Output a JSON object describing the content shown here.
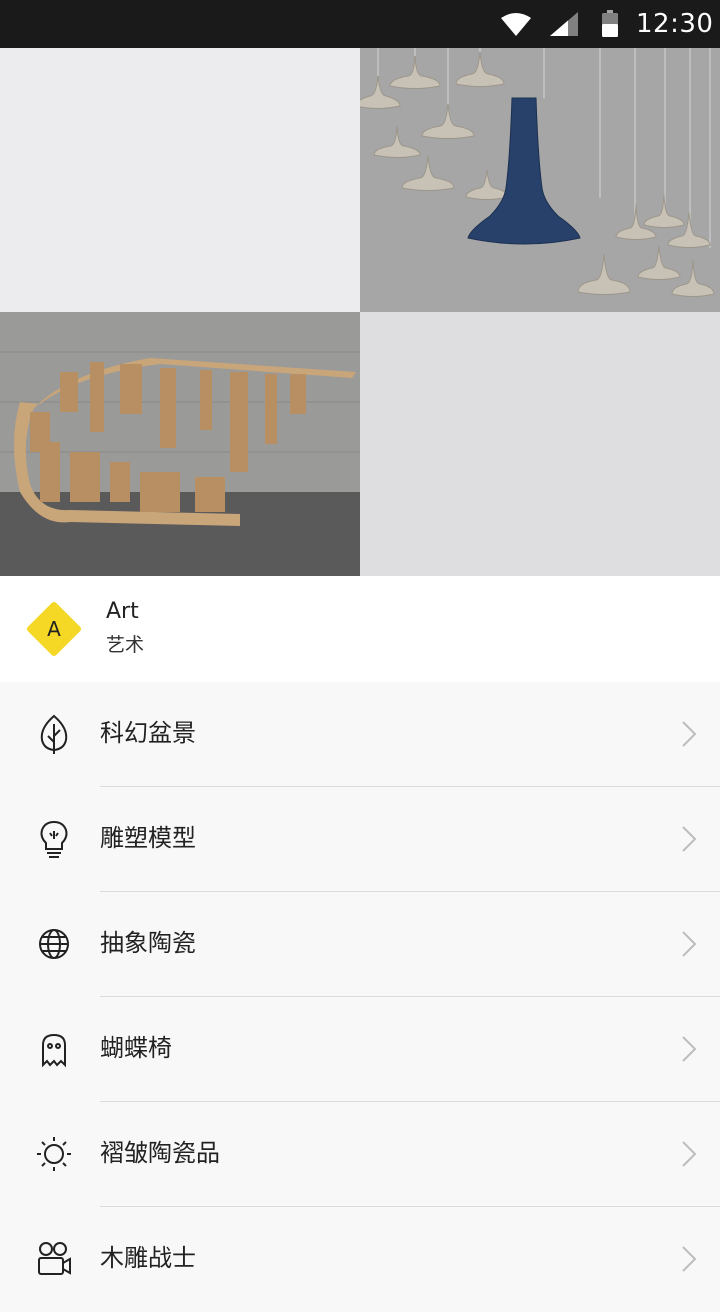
{
  "status_bar": {
    "time": "12:30"
  },
  "header": {
    "badge_letter": "A",
    "title": "Art",
    "subtitle": "艺术"
  },
  "menu": {
    "items": [
      {
        "label": "科幻盆景",
        "icon": "leaf-icon"
      },
      {
        "label": "雕塑模型",
        "icon": "lightbulb-icon"
      },
      {
        "label": "抽象陶瓷",
        "icon": "globe-icon"
      },
      {
        "label": "蝴蝶椅",
        "icon": "ghost-icon"
      },
      {
        "label": "褶皱陶瓷品",
        "icon": "sun-icon"
      },
      {
        "label": "木雕战士",
        "icon": "video-camera-icon"
      }
    ]
  },
  "colors": {
    "accent": "#f5d726",
    "status_bar": "#1a1a1a",
    "lamp_blue": "#27416a"
  }
}
